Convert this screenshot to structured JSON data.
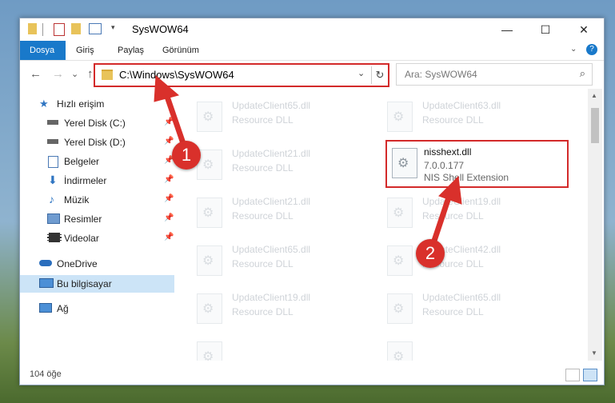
{
  "window": {
    "title": "SysWOW64",
    "controls": {
      "minimize": "—",
      "maximize": "☐",
      "close": "✕"
    }
  },
  "ribbon": {
    "tabs": [
      "Dosya",
      "Giriş",
      "Paylaş",
      "Görünüm"
    ]
  },
  "navigation": {
    "back": "←",
    "forward": "→",
    "recent": "⌄",
    "up": "↑",
    "address": "C:\\Windows\\SysWOW64",
    "search_placeholder": "Ara: SysWOW64"
  },
  "sidebar": {
    "items": [
      {
        "label": "Hızlı erişim",
        "icon": "star-icon"
      },
      {
        "label": "Yerel Disk (C:)",
        "icon": "drive-icon",
        "pinned": true
      },
      {
        "label": "Yerel Disk (D:)",
        "icon": "drive-icon",
        "pinned": true
      },
      {
        "label": "Belgeler",
        "icon": "documents-icon",
        "pinned": true
      },
      {
        "label": "İndirmeler",
        "icon": "download-icon",
        "pinned": true
      },
      {
        "label": "Müzik",
        "icon": "music-icon",
        "pinned": true
      },
      {
        "label": "Resimler",
        "icon": "pictures-icon",
        "pinned": true
      },
      {
        "label": "Videolar",
        "icon": "video-icon",
        "pinned": true
      },
      {
        "label": "OneDrive",
        "icon": "cloud-icon"
      },
      {
        "label": "Bu bilgisayar",
        "icon": "computer-icon",
        "selected": true
      },
      {
        "label": "Ağ",
        "icon": "network-icon"
      }
    ]
  },
  "files": [
    {
      "name": "UpdateClient65.dll",
      "desc": "Resource DLL"
    },
    {
      "name": "UpdateClient63.dll",
      "desc": "Resource DLL"
    },
    {
      "name": "UpdateClient21.dll",
      "desc": "Resource DLL"
    },
    {
      "name": "nisshext.dll",
      "version": "7.0.0.177",
      "desc": "NIS Shell Extension"
    },
    {
      "name": "UpdateClient21.dll",
      "desc": "Resource DLL"
    },
    {
      "name": "UpdateClient19.dll",
      "desc": "Resource DLL"
    },
    {
      "name": "UpdateClient65.dll",
      "desc": "Resource DLL"
    },
    {
      "name": "UpdateClient42.dll",
      "desc": "Resource DLL"
    },
    {
      "name": "UpdateClient19.dll",
      "desc": "Resource DLL"
    },
    {
      "name": "UpdateClient65.dll",
      "desc": "Resource DLL"
    }
  ],
  "status": {
    "count": "104 öğe"
  },
  "annotations": {
    "badge1": "1",
    "badge2": "2"
  },
  "colors": {
    "accent": "#1979ca",
    "highlight": "#d32a2a",
    "selected": "#cce4f7"
  }
}
